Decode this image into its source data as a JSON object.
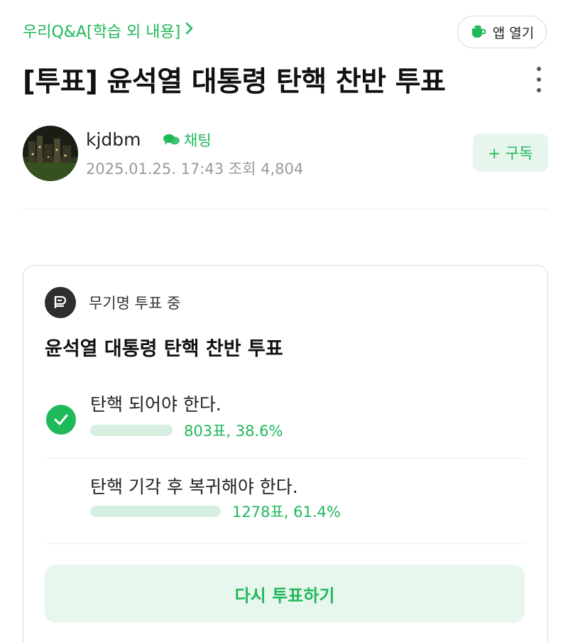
{
  "header": {
    "breadcrumb": "우리Q&A[학습 외 내용]",
    "app_button_label": "앱 열기",
    "icons": {
      "app": "cup-icon",
      "breadcrumb": "chevron-right-icon",
      "more": "more-vertical-icon"
    }
  },
  "post": {
    "title": "[투표] 윤석열 대통령 탄핵 찬반 투표"
  },
  "author": {
    "name": "kjdbm",
    "chat_label": "채팅",
    "meta": "2025.01.25. 17:43 조회 4,804",
    "subscribe_label": "+ 구독",
    "icons": {
      "avatar": "night-city-avatar",
      "chat": "chat-bubbles-icon"
    }
  },
  "poll": {
    "status": "무기명 투표 중",
    "title": "윤석열 대통령 탄핵 찬반 투표",
    "options": [
      {
        "label": "탄핵 되어야 한다.",
        "result": "803표, 38.6%",
        "percent": 38.6,
        "selected": true
      },
      {
        "label": "탄핵 기각 후 복귀해야 한다.",
        "result": "1278표, 61.4%",
        "percent": 61.4,
        "selected": false
      }
    ],
    "revote_label": "다시 투표하기",
    "icons": {
      "poll": "poll-icon",
      "selected": "check-icon"
    }
  },
  "colors": {
    "accent": "#1fb85a",
    "accent_light": "#e8f7ee",
    "bar": "#d7efe0",
    "meta_text": "#9a9a9a"
  }
}
